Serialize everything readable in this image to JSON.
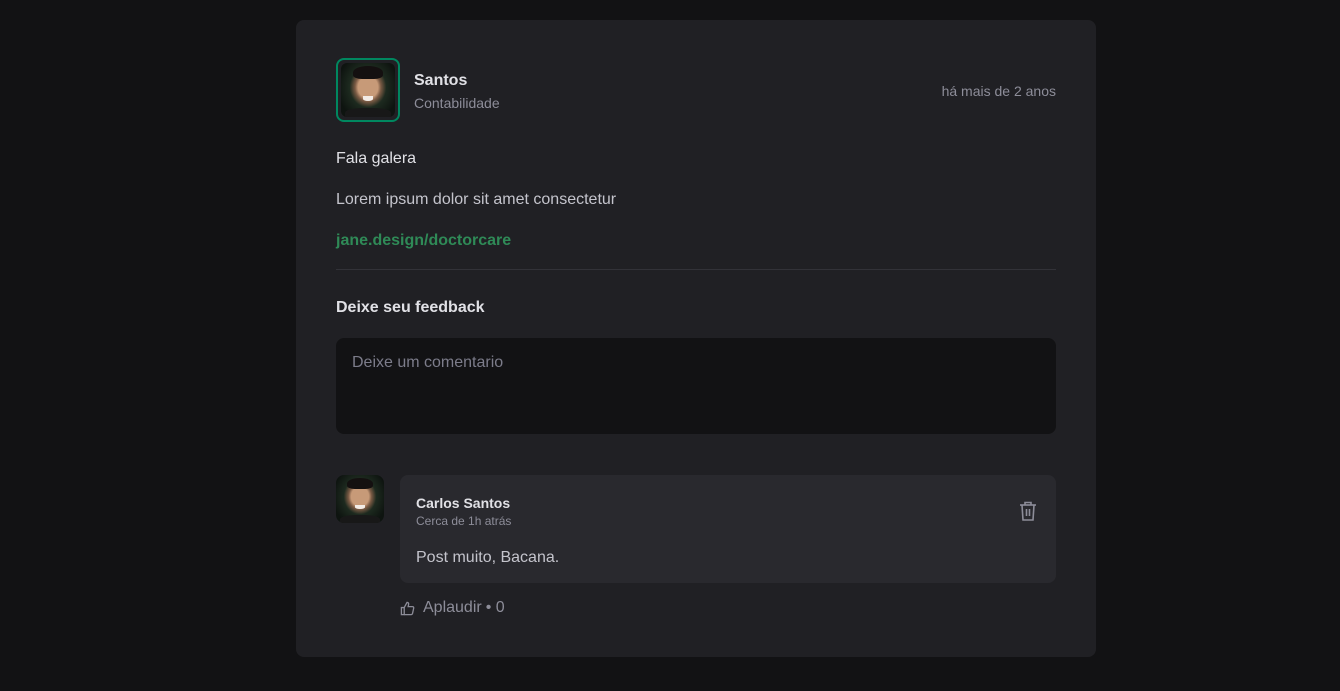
{
  "post": {
    "author": {
      "name": "Santos",
      "role": "Contabilidade"
    },
    "published_label": "há mais de 2 anos",
    "content": {
      "line1": "Fala galera",
      "line2": "Lorem ipsum dolor sit amet consectetur",
      "link": "jane.design/doctorcare"
    },
    "feedback_title": "Deixe seu feedback",
    "comment_placeholder": "Deixe um comentario"
  },
  "comments": [
    {
      "author": "Carlos Santos",
      "time": "Cerca de 1h atrás",
      "text": "Post muito, Bacana.",
      "applaud_label": "Aplaudir",
      "applaud_count": "• 0"
    }
  ],
  "colors": {
    "background": "#121214",
    "card": "#202024",
    "accent": "#00875f",
    "link": "#2f8a57"
  }
}
